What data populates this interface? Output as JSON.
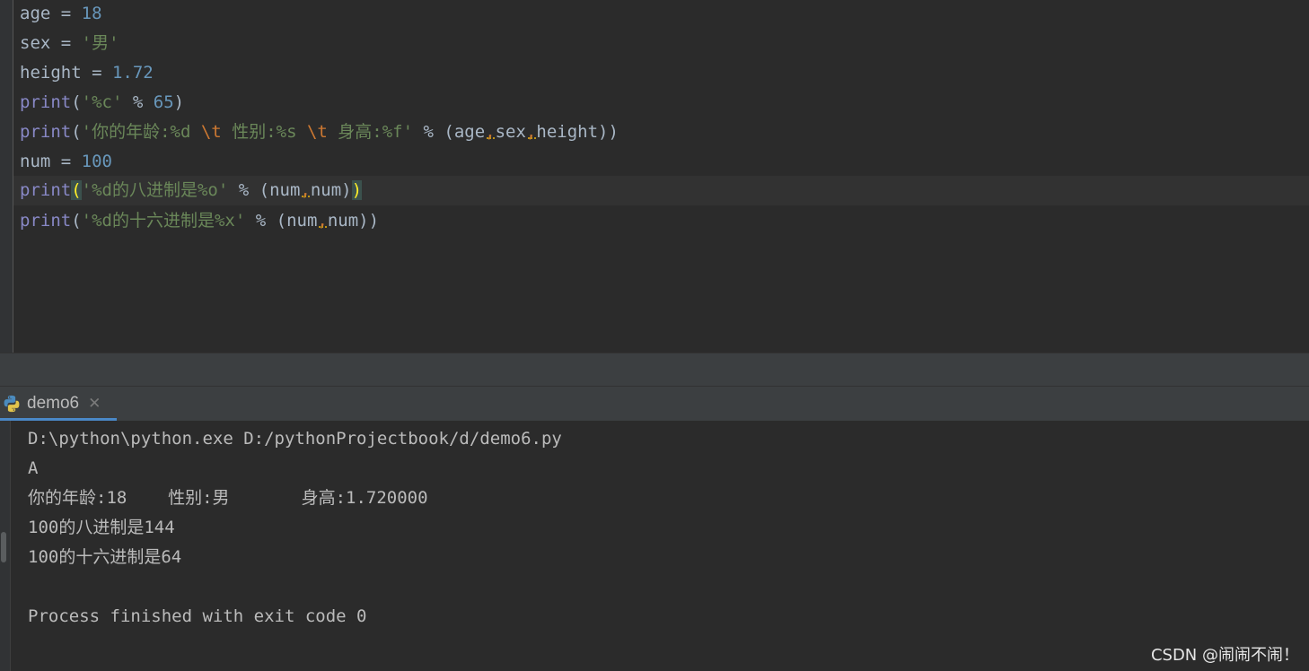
{
  "editor": {
    "line1": {
      "name": "age",
      "op": " = ",
      "value": "18"
    },
    "line2": {
      "name": "sex",
      "op": " = ",
      "value": "'男'"
    },
    "line3": {
      "name": "height",
      "op": " = ",
      "value": "1.72"
    },
    "line4": {
      "fn": "print",
      "open": "(",
      "str": "'%c'",
      "mod": " % ",
      "value": "65",
      "close": ")"
    },
    "line5": {
      "fn": "print",
      "open": "(",
      "s1": "'你的年龄:%d ",
      "e1": "\\t",
      "s2": " 性别:%s ",
      "e2": "\\t",
      "s3": " 身高:%f'",
      "mod": " % (",
      "a1": "age",
      "c1": ",",
      "a2": "sex",
      "c2": ",",
      "a3": "height",
      "close": "))"
    },
    "line6": {
      "name": "num",
      "op": " = ",
      "value": "100"
    },
    "line7": {
      "fn": "print",
      "open": "(",
      "str": "'%d的八进制是%o'",
      "mod": " % (",
      "a1": "num",
      "c1": ",",
      "a2": "num",
      "close1": ")",
      "close2": ")"
    },
    "line8": {
      "fn": "print",
      "open": "(",
      "str": "'%d的十六进制是%x'",
      "mod": " % (",
      "a1": "num",
      "c1": ",",
      "a2": "num",
      "close": "))"
    }
  },
  "run": {
    "tab_label": "demo6",
    "close_glyph": "✕",
    "console_lines": [
      "D:\\python\\python.exe D:/pythonProjectbook/d/demo6.py",
      "A",
      "你的年龄:18    性别:男       身高:1.720000",
      "100的八进制是144",
      "100的十六进制是64",
      "",
      "Process finished with exit code 0"
    ]
  },
  "watermark": "CSDN @闹闹不闹！",
  "colors": {
    "background": "#2b2b2b",
    "keyword_builtin": "#8888c6",
    "number": "#6897bb",
    "string": "#6a8759",
    "escape": "#cc7832",
    "accent_tab": "#4a88c7"
  },
  "icons": {
    "run_tab": "python-icon",
    "close": "close-icon"
  }
}
